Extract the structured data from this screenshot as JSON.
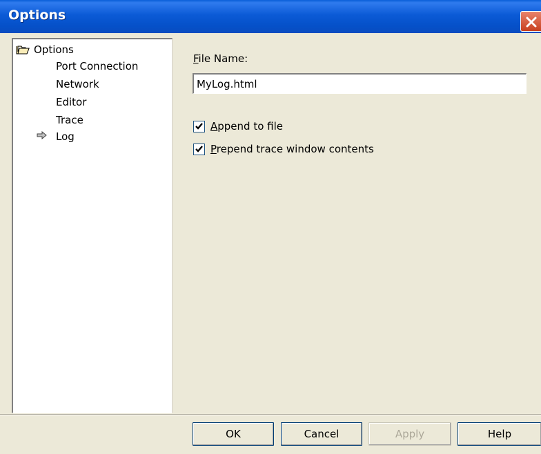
{
  "window": {
    "title": "Options"
  },
  "tree": {
    "root_label": "Options",
    "items": [
      {
        "label": "Port Connection"
      },
      {
        "label": "Network"
      },
      {
        "label": "Editor"
      },
      {
        "label": "Trace"
      },
      {
        "label": "Log",
        "selected": true
      }
    ]
  },
  "log_panel": {
    "file_name_label_first": "F",
    "file_name_label_rest": "ile Name:",
    "file_name_value": "MyLog.html",
    "append_label_first": "A",
    "append_label_rest": "ppend to file",
    "append_checked": true,
    "prepend_label_first": "P",
    "prepend_label_rest": "repend trace window contents",
    "prepend_checked": true
  },
  "buttons": {
    "ok": "OK",
    "cancel": "Cancel",
    "apply": "Apply",
    "help": "Help"
  }
}
